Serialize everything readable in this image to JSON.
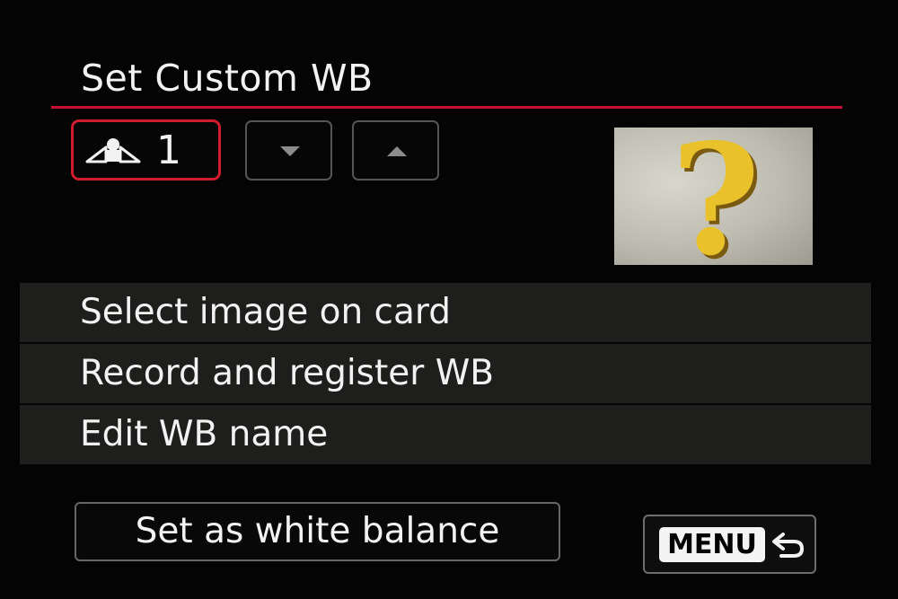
{
  "header": {
    "title": "Set Custom WB"
  },
  "wb_selector": {
    "icon": "custom-wb-icon",
    "slot_number": "1"
  },
  "arrows": {
    "down": "down-arrow-icon",
    "up": "up-arrow-icon"
  },
  "preview": {
    "glyph": "?"
  },
  "menu": {
    "items": [
      {
        "label": "Select image on card"
      },
      {
        "label": "Record and register WB"
      },
      {
        "label": "Edit WB name"
      }
    ]
  },
  "footer": {
    "set_button_label": "Set as white balance",
    "menu_key_label": "MENU",
    "back_icon": "return-arrow-icon"
  },
  "colors": {
    "accent": "#d01c2c",
    "background": "#040404",
    "row": "#1e1e1c",
    "question_mark": "#e9c12a"
  }
}
